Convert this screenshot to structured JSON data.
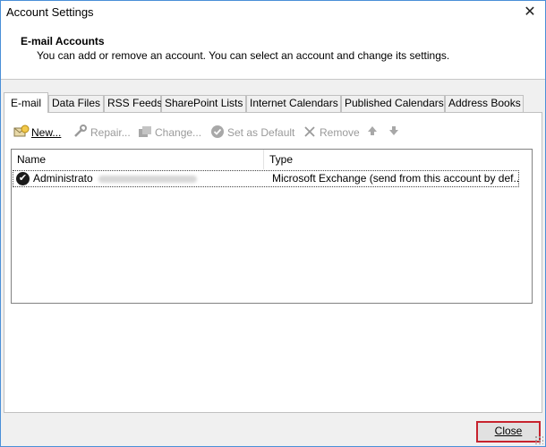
{
  "window": {
    "title": "Account Settings",
    "close_glyph": "✕"
  },
  "header": {
    "title": "E-mail Accounts",
    "description": "You can add or remove an account. You can select an account and change its settings."
  },
  "tabs": [
    {
      "label": "E-mail",
      "active": true
    },
    {
      "label": "Data Files"
    },
    {
      "label": "RSS Feeds"
    },
    {
      "label": "SharePoint Lists"
    },
    {
      "label": "Internet Calendars"
    },
    {
      "label": "Published Calendars"
    },
    {
      "label": "Address Books"
    }
  ],
  "toolbar": {
    "new_label": "New...",
    "repair_label": "Repair...",
    "change_label": "Change...",
    "set_default_label": "Set as Default",
    "remove_label": "Remove",
    "icons": {
      "new": "new-account-icon",
      "repair": "repair-icon",
      "change": "change-icon",
      "set_default": "checkmark-circle-icon",
      "remove": "remove-x-icon",
      "up": "arrow-up-icon",
      "down": "arrow-down-icon"
    }
  },
  "accounts_list": {
    "columns": [
      "Name",
      "Type"
    ],
    "rows": [
      {
        "name": "Administrato",
        "type": "Microsoft Exchange (send from this account by def..."
      }
    ]
  },
  "footer": {
    "close_label": "Close",
    "close_highlight_color": "#c7232e"
  }
}
